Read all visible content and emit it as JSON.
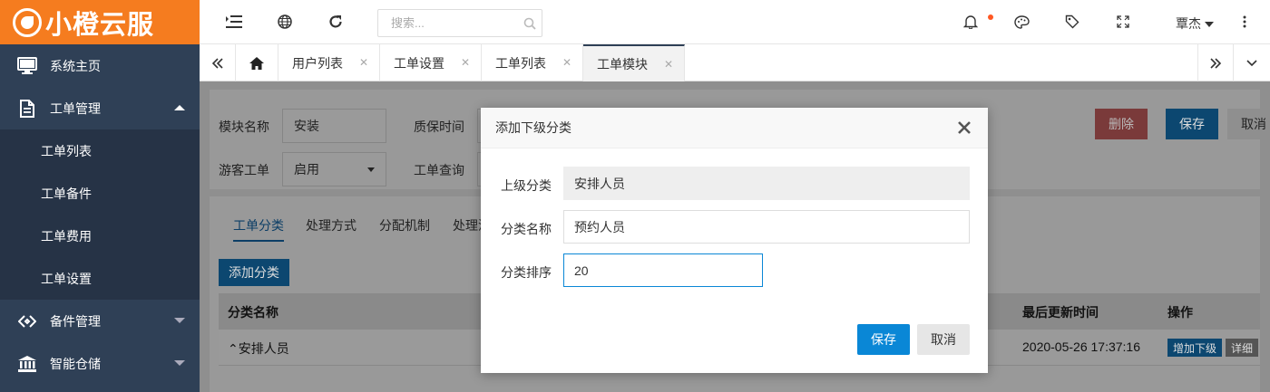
{
  "brand": {
    "name": "小橙云服"
  },
  "sidebar": {
    "items": [
      {
        "label": "系统主页",
        "icon": "monitor-icon"
      },
      {
        "label": "工单管理",
        "icon": "document-icon",
        "expanded": true,
        "children": [
          "工单列表",
          "工单备件",
          "工单费用",
          "工单设置"
        ]
      },
      {
        "label": "备件管理",
        "icon": "diamond-icon"
      },
      {
        "label": "智能仓储",
        "icon": "bank-icon"
      }
    ]
  },
  "topbar": {
    "search_placeholder": "搜索...",
    "user_name": "覃杰"
  },
  "tabs": {
    "items": [
      "用户列表",
      "工单设置",
      "工单列表",
      "工单模块"
    ],
    "active": "工单模块"
  },
  "form": {
    "module_name_label": "模块名称",
    "module_name_value": "安装",
    "warranty_label": "质保时间",
    "guest_label": "游客工单",
    "guest_value": "启用",
    "query_label": "工单查询",
    "delete_label": "删除",
    "save_label": "保存",
    "cancel_label": "取消"
  },
  "subtabs": [
    "工单分类",
    "处理方式",
    "分配机制",
    "处理流"
  ],
  "add_category_label": "添加分类",
  "table": {
    "headers": {
      "name": "分类名称",
      "updated": "最后更新时间",
      "actions": "操作"
    },
    "rows": [
      {
        "name": "⌃安排人员",
        "updated": "2020-05-26 17:37:16",
        "add_child": "增加下级",
        "detail": "详细"
      }
    ]
  },
  "modal": {
    "title": "添加下级分类",
    "parent_label": "上级分类",
    "parent_value": "安排人员",
    "name_label": "分类名称",
    "name_value": "预约人员",
    "order_label": "分类排序",
    "order_value": "20",
    "save_label": "保存",
    "cancel_label": "取消"
  },
  "colors": {
    "brand": "#f57c1f",
    "sidebar": "#2f4056",
    "primary": "#0a87d6",
    "danger": "#d9534f"
  }
}
